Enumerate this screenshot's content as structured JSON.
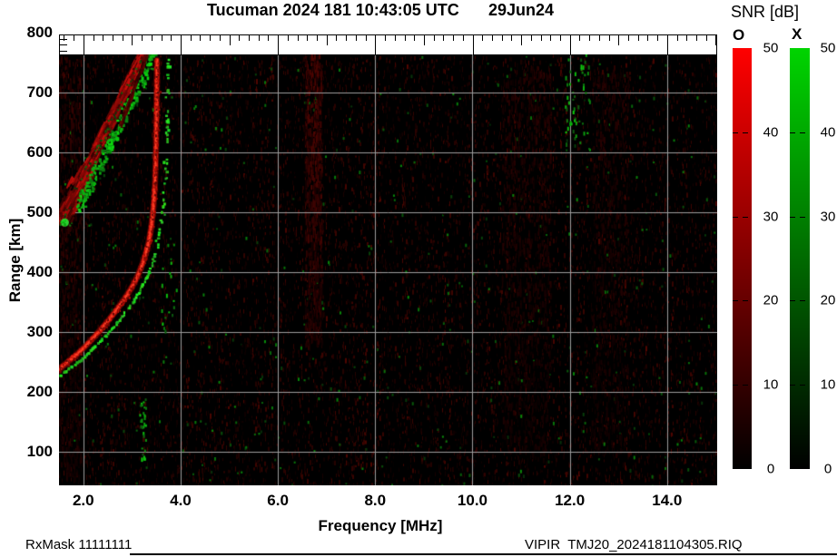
{
  "title": {
    "text": "Tucuman 2024 181 10:43:05 UTC",
    "date": "29Jun24"
  },
  "footer": {
    "rx_mask": "RxMask 11111111",
    "file": "VIPIR  TMJ20_2024181104305.RIQ"
  },
  "colorbar": {
    "title": "SNR [dB]",
    "tick_labels": [
      "50",
      "40",
      "30",
      "20",
      "10",
      "0"
    ],
    "bars": [
      {
        "label": "O",
        "top_color": "#ff0000",
        "bottom_color": "#000000"
      },
      {
        "label": "X",
        "top_color": "#00d400",
        "bottom_color": "#000000"
      }
    ]
  },
  "chart_data": {
    "type": "heatmap",
    "title": "Ionogram SNR vs frequency and virtual range",
    "xlabel": "Frequency [MHz]",
    "ylabel": "Range [km]",
    "xlim": [
      1.5,
      15.03
    ],
    "ylim": [
      44,
      797
    ],
    "x_ticks": {
      "values": [
        2,
        4,
        6,
        8,
        10,
        12,
        14
      ],
      "labels": [
        "2.0",
        "4.0",
        "6.0",
        "8.0",
        "10.0",
        "12.0",
        "14.0"
      ],
      "minor_step": 0.2
    },
    "y_ticks": {
      "values": [
        800,
        700,
        600,
        500,
        400,
        300,
        200,
        100
      ],
      "labels": [
        "800",
        "700",
        "600",
        "500",
        "400",
        "300",
        "200",
        "100"
      ],
      "strip_minor": [
        790,
        780,
        770
      ]
    },
    "grid": true,
    "grid_color": "#9c9c9c",
    "background_color": "#000000",
    "colorbar_range": [
      0,
      50
    ],
    "seed": 77,
    "traces": [
      {
        "name": "O-mode F-layer trace",
        "color": "#ff2010",
        "points": [
          [
            1.5,
            238
          ],
          [
            1.65,
            248
          ],
          [
            1.8,
            258
          ],
          [
            1.95,
            269
          ],
          [
            2.1,
            281
          ],
          [
            2.25,
            294
          ],
          [
            2.4,
            308
          ],
          [
            2.55,
            323
          ],
          [
            2.7,
            339
          ],
          [
            2.85,
            356
          ],
          [
            3.0,
            375
          ],
          [
            3.1,
            391
          ],
          [
            3.2,
            410
          ],
          [
            3.28,
            430
          ],
          [
            3.35,
            452
          ],
          [
            3.4,
            478
          ],
          [
            3.44,
            508
          ],
          [
            3.47,
            545
          ],
          [
            3.49,
            590
          ],
          [
            3.5,
            640
          ],
          [
            3.51,
            695
          ],
          [
            3.515,
            755
          ]
        ]
      },
      {
        "name": "X-mode F-layer trace",
        "color": "#28c832",
        "points": [
          [
            1.5,
            229
          ],
          [
            1.7,
            241
          ],
          [
            1.9,
            254
          ],
          [
            2.1,
            268
          ],
          [
            2.3,
            284
          ],
          [
            2.5,
            301
          ],
          [
            2.7,
            320
          ],
          [
            2.9,
            341
          ],
          [
            3.1,
            365
          ],
          [
            3.25,
            388
          ],
          [
            3.38,
            413
          ],
          [
            3.48,
            441
          ],
          [
            3.56,
            472
          ],
          [
            3.62,
            506
          ],
          [
            3.66,
            548
          ],
          [
            3.69,
            598
          ],
          [
            3.71,
            655
          ],
          [
            3.72,
            712
          ],
          [
            3.73,
            760
          ]
        ]
      }
    ],
    "spread_band": {
      "name": "oblique spread-F echo band",
      "from": [
        1.5,
        478
      ],
      "to": [
        3.28,
        772
      ],
      "stroke_count": 950,
      "green_edge_count": 240,
      "blob": [
        1.62,
        483
      ]
    },
    "secondary_streak": {
      "from": [
        2.75,
        640
      ],
      "to": [
        3.3,
        762
      ],
      "stroke_count": 130
    },
    "interference_bands": [
      {
        "f0": 6.55,
        "f1": 6.9,
        "r0": 280,
        "r1": 765,
        "strength": 0.85
      },
      {
        "f0": 10.6,
        "f1": 11.6,
        "r0": 100,
        "r1": 740,
        "strength": 0.34
      },
      {
        "f0": 12.45,
        "f1": 13.2,
        "r0": 100,
        "r1": 740,
        "strength": 0.3
      },
      {
        "f0": 1.5,
        "f1": 1.95,
        "r0": 60,
        "r1": 760,
        "strength": 0.5
      }
    ],
    "green_artifacts": [
      {
        "f0": 3.15,
        "f1": 3.28,
        "r0": 90,
        "r1": 195,
        "count": 30
      },
      {
        "f0": 11.9,
        "f1": 12.4,
        "r0": 600,
        "r1": 770,
        "count": 50
      },
      {
        "f0": 3.6,
        "f1": 3.95,
        "r0": 250,
        "r1": 420,
        "count": 18
      }
    ],
    "noise": {
      "red_dashes_per_col_min": 9,
      "red_dashes_per_col_rand": 13,
      "green_speckles": 430
    }
  }
}
